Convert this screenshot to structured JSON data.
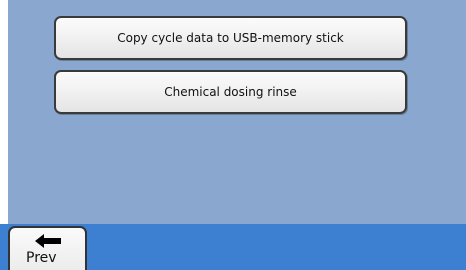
{
  "menu": {
    "items": [
      {
        "label": "Copy cycle data to USB-memory stick"
      },
      {
        "label": "Chemical dosing rinse"
      }
    ]
  },
  "footer": {
    "prev_label": "Prev",
    "prev_icon": "left-arrow-icon"
  },
  "colors": {
    "panel_background": "#8aa8cf",
    "footer_bar": "#3d7fd0",
    "button_face": "#f2f2f2"
  }
}
